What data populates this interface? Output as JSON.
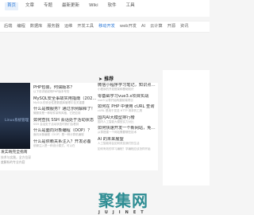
{
  "nav": {
    "items": [
      {
        "label": "首页",
        "active": true
      },
      {
        "label": "文章"
      },
      {
        "label": "专题"
      },
      {
        "label": "最新更新"
      },
      {
        "label": "Wiki"
      },
      {
        "label": "软件"
      },
      {
        "label": "工具"
      }
    ]
  },
  "tags": {
    "items": [
      {
        "label": "后端"
      },
      {
        "label": "编程"
      },
      {
        "label": "数据库"
      },
      {
        "label": "服务器"
      },
      {
        "label": "运维"
      },
      {
        "label": "开发工具"
      },
      {
        "label": "移动开发",
        "active": true
      },
      {
        "label": "web开发"
      },
      {
        "label": "AI"
      },
      {
        "label": "云计算"
      },
      {
        "label": "开源"
      },
      {
        "label": "资讯"
      }
    ]
  },
  "main": {
    "thumb_caption": "Linux系统管理",
    "below_title": "发实践完全指南",
    "below_sub": "技术与实践，全方位深度解析的专业内容",
    "list": [
      {
        "title": "PHP包装，何谓版本？",
        "sub": "以下将详细说明PHP版本号的"
      },
      {
        "title": "MySQL安全事故实用指南（2024版）",
        "sub": "MySQL的安全性是数据库管理中至关重要"
      },
      {
        "title": "什么是微服务？通过示例解释了！",
        "sub": "微服务是一种软件架构风格，它把应用"
      },
      {
        "title": "如何查找 SSH 会话处于活动状态",
        "sub": "SSH 会话处于活动状态时我们会看到"
      },
      {
        "title": "什么是面向对象编程（OOP）？",
        "sub": "面向对象编程（OOP）是一种计算机编程"
      },
      {
        "title": "什么是依赖关系注入？开发必备",
        "sub": "依赖注入是一种设计模式，可以在"
      }
    ]
  },
  "recommend": {
    "heading": "推荐",
    "items": [
      {
        "title": "微信小程序学习笔记，知识点全面梳理",
        "sub": "小程序的开发框架和基础知识"
      },
      {
        "title": "零基础学习vue3.x项目实战",
        "sub": "vue3 从零开始构建前端项目"
      },
      {
        "title": "如何在 PHP 中使用 cURL 查询",
        "sub": "cURL 是用于发送 HTTP 请求的工具"
      },
      {
        "title": "国内AI大模型排行榜",
        "sub": "国内人工智能大模型实力对比"
      },
      {
        "title": "如何快速开发一个新网站，免费可",
        "sub": "从零搭建一个网站需要哪些技术"
      },
      {
        "title": "AI 的未来展望",
        "sub": "人工智能将会如何改变我们的生活"
      },
      {
        "title": "",
        "sub": "如何有效的学习编程？学编程应该怎样开始"
      }
    ]
  },
  "footer": {
    "logo": "聚集网",
    "sub": "JUJINET"
  },
  "colors": {
    "accent": "#2f7bd8",
    "logo": "#2e8d93"
  }
}
